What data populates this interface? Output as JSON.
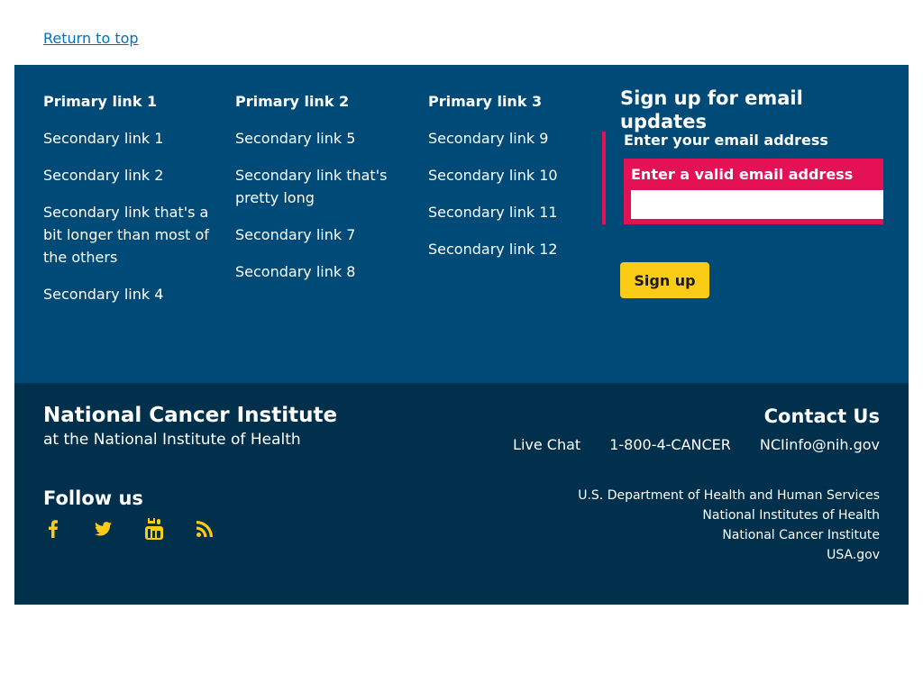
{
  "return_to_top": "Return to top",
  "footer_columns": [
    {
      "title": "Primary link 1",
      "links": [
        "Secondary link 1",
        "Secondary link 2",
        "Secondary link that's a bit longer than most of the others",
        "Secondary link 4"
      ]
    },
    {
      "title": "Primary link 2",
      "links": [
        "Secondary link 5",
        "Secondary link that's pretty long",
        "Secondary link 7",
        "Secondary link 8"
      ]
    },
    {
      "title": "Primary link 3",
      "links": [
        "Secondary link 9",
        "Secondary link 10",
        "Secondary link 11",
        "Secondary link 12"
      ]
    }
  ],
  "signup": {
    "title": "Sign up for email updates",
    "label": "Enter your email address",
    "error": "Enter a valid email address",
    "input_value": "",
    "button": "Sign up"
  },
  "org": {
    "name": "National Cancer Institute",
    "subtitle": "at the National Institute of Health"
  },
  "contact": {
    "title": "Contact Us",
    "links": [
      "Live Chat",
      "1-800-4-CANCER",
      "NCIinfo@nih.gov"
    ]
  },
  "follow": {
    "title": "Follow us",
    "icons": [
      "facebook-icon",
      "twitter-icon",
      "youtube-icon",
      "rss-icon"
    ]
  },
  "gov_links": [
    "U.S. Department of Health and Human Services",
    "National Institutes of Health",
    "National Cancer Institute",
    "USA.gov"
  ],
  "colors": {
    "primary_bg": "#004a77",
    "secondary_bg": "#00304c",
    "error": "#e41154",
    "button": "#facc15",
    "link": "#0071bc",
    "icon": "#facc15"
  }
}
